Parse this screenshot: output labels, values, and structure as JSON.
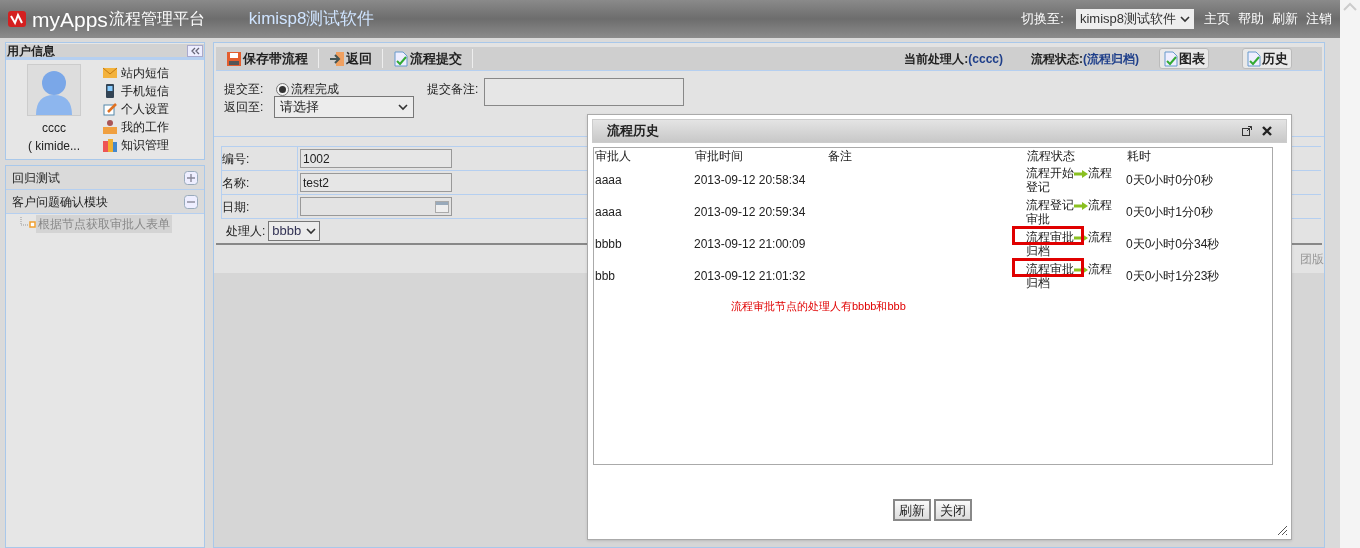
{
  "header": {
    "brand": "myApps",
    "platform": "流程管理平台",
    "app_name": "kimisp8测试软件",
    "switch_label": "切换至:",
    "switch_value": "kimisp8测试软件",
    "links": [
      "主页",
      "帮助",
      "刷新",
      "注销"
    ]
  },
  "user_panel": {
    "title": "用户信息",
    "user_name": "cccc",
    "user_org": "( kimide...",
    "links": [
      {
        "kind": "mail",
        "label": "站内短信"
      },
      {
        "kind": "phone",
        "label": "手机短信"
      },
      {
        "kind": "settings",
        "label": "个人设置"
      },
      {
        "kind": "work",
        "label": "我的工作"
      },
      {
        "kind": "knowledge",
        "label": "知识管理"
      }
    ]
  },
  "modules": [
    {
      "label": "回归测试",
      "expanded": false
    },
    {
      "label": "客户问题确认模块",
      "expanded": true,
      "children": [
        {
          "label": "根据节点获取审批人表单",
          "selected": true
        }
      ]
    }
  ],
  "toolbar": {
    "buttons": [
      {
        "kind": "save",
        "label": "保存带流程"
      },
      {
        "kind": "back",
        "label": "返回"
      },
      {
        "kind": "submit",
        "label": "流程提交"
      }
    ],
    "current_handler_label": "当前处理人:",
    "current_handler": "(cccc)",
    "status_label": "流程状态:",
    "status": "(流程归档)",
    "right_buttons": [
      "图表",
      "历史"
    ]
  },
  "submit_form": {
    "submit_to_label": "提交至:",
    "submit_option": {
      "label": "流程完成",
      "checked": true
    },
    "return_to_label": "返回至:",
    "return_to_value": "请选择",
    "remark_label": "提交备注:"
  },
  "form_fields": [
    {
      "kind": "text",
      "label": "编号:",
      "value": "1002"
    },
    {
      "kind": "text",
      "label": "名称:",
      "value": "test2"
    },
    {
      "kind": "date",
      "label": "日期:"
    }
  ],
  "handler": {
    "label": "处理人:",
    "value": "bbbb"
  },
  "hidden_text": "团版",
  "dialog": {
    "title": "流程历史",
    "columns": [
      "审批人",
      "审批时间",
      "备注",
      "流程状态",
      "耗时"
    ],
    "rows": [
      {
        "approver": "aaaa",
        "time": "2013-09-12 20:58:34",
        "from": "流程开始",
        "to": "流程登记",
        "duration": "0天0小时0分0秒",
        "highlighted": false
      },
      {
        "approver": "aaaa",
        "time": "2013-09-12 20:59:34",
        "from": "流程登记",
        "to": "流程审批",
        "duration": "0天0小时1分0秒",
        "highlighted": false
      },
      {
        "approver": "bbbb",
        "time": "2013-09-12 21:00:09",
        "from": "流程审批",
        "to": "流程归档",
        "duration": "0天0小时0分34秒",
        "highlighted": true
      },
      {
        "approver": "bbb",
        "time": "2013-09-12 21:01:32",
        "from": "流程审批",
        "to": "流程归档",
        "duration": "0天0小时1分23秒",
        "highlighted": true
      }
    ],
    "note": "流程审批节点的处理人有bbbb和bbb",
    "buttons": [
      "刷新",
      "关闭"
    ]
  }
}
